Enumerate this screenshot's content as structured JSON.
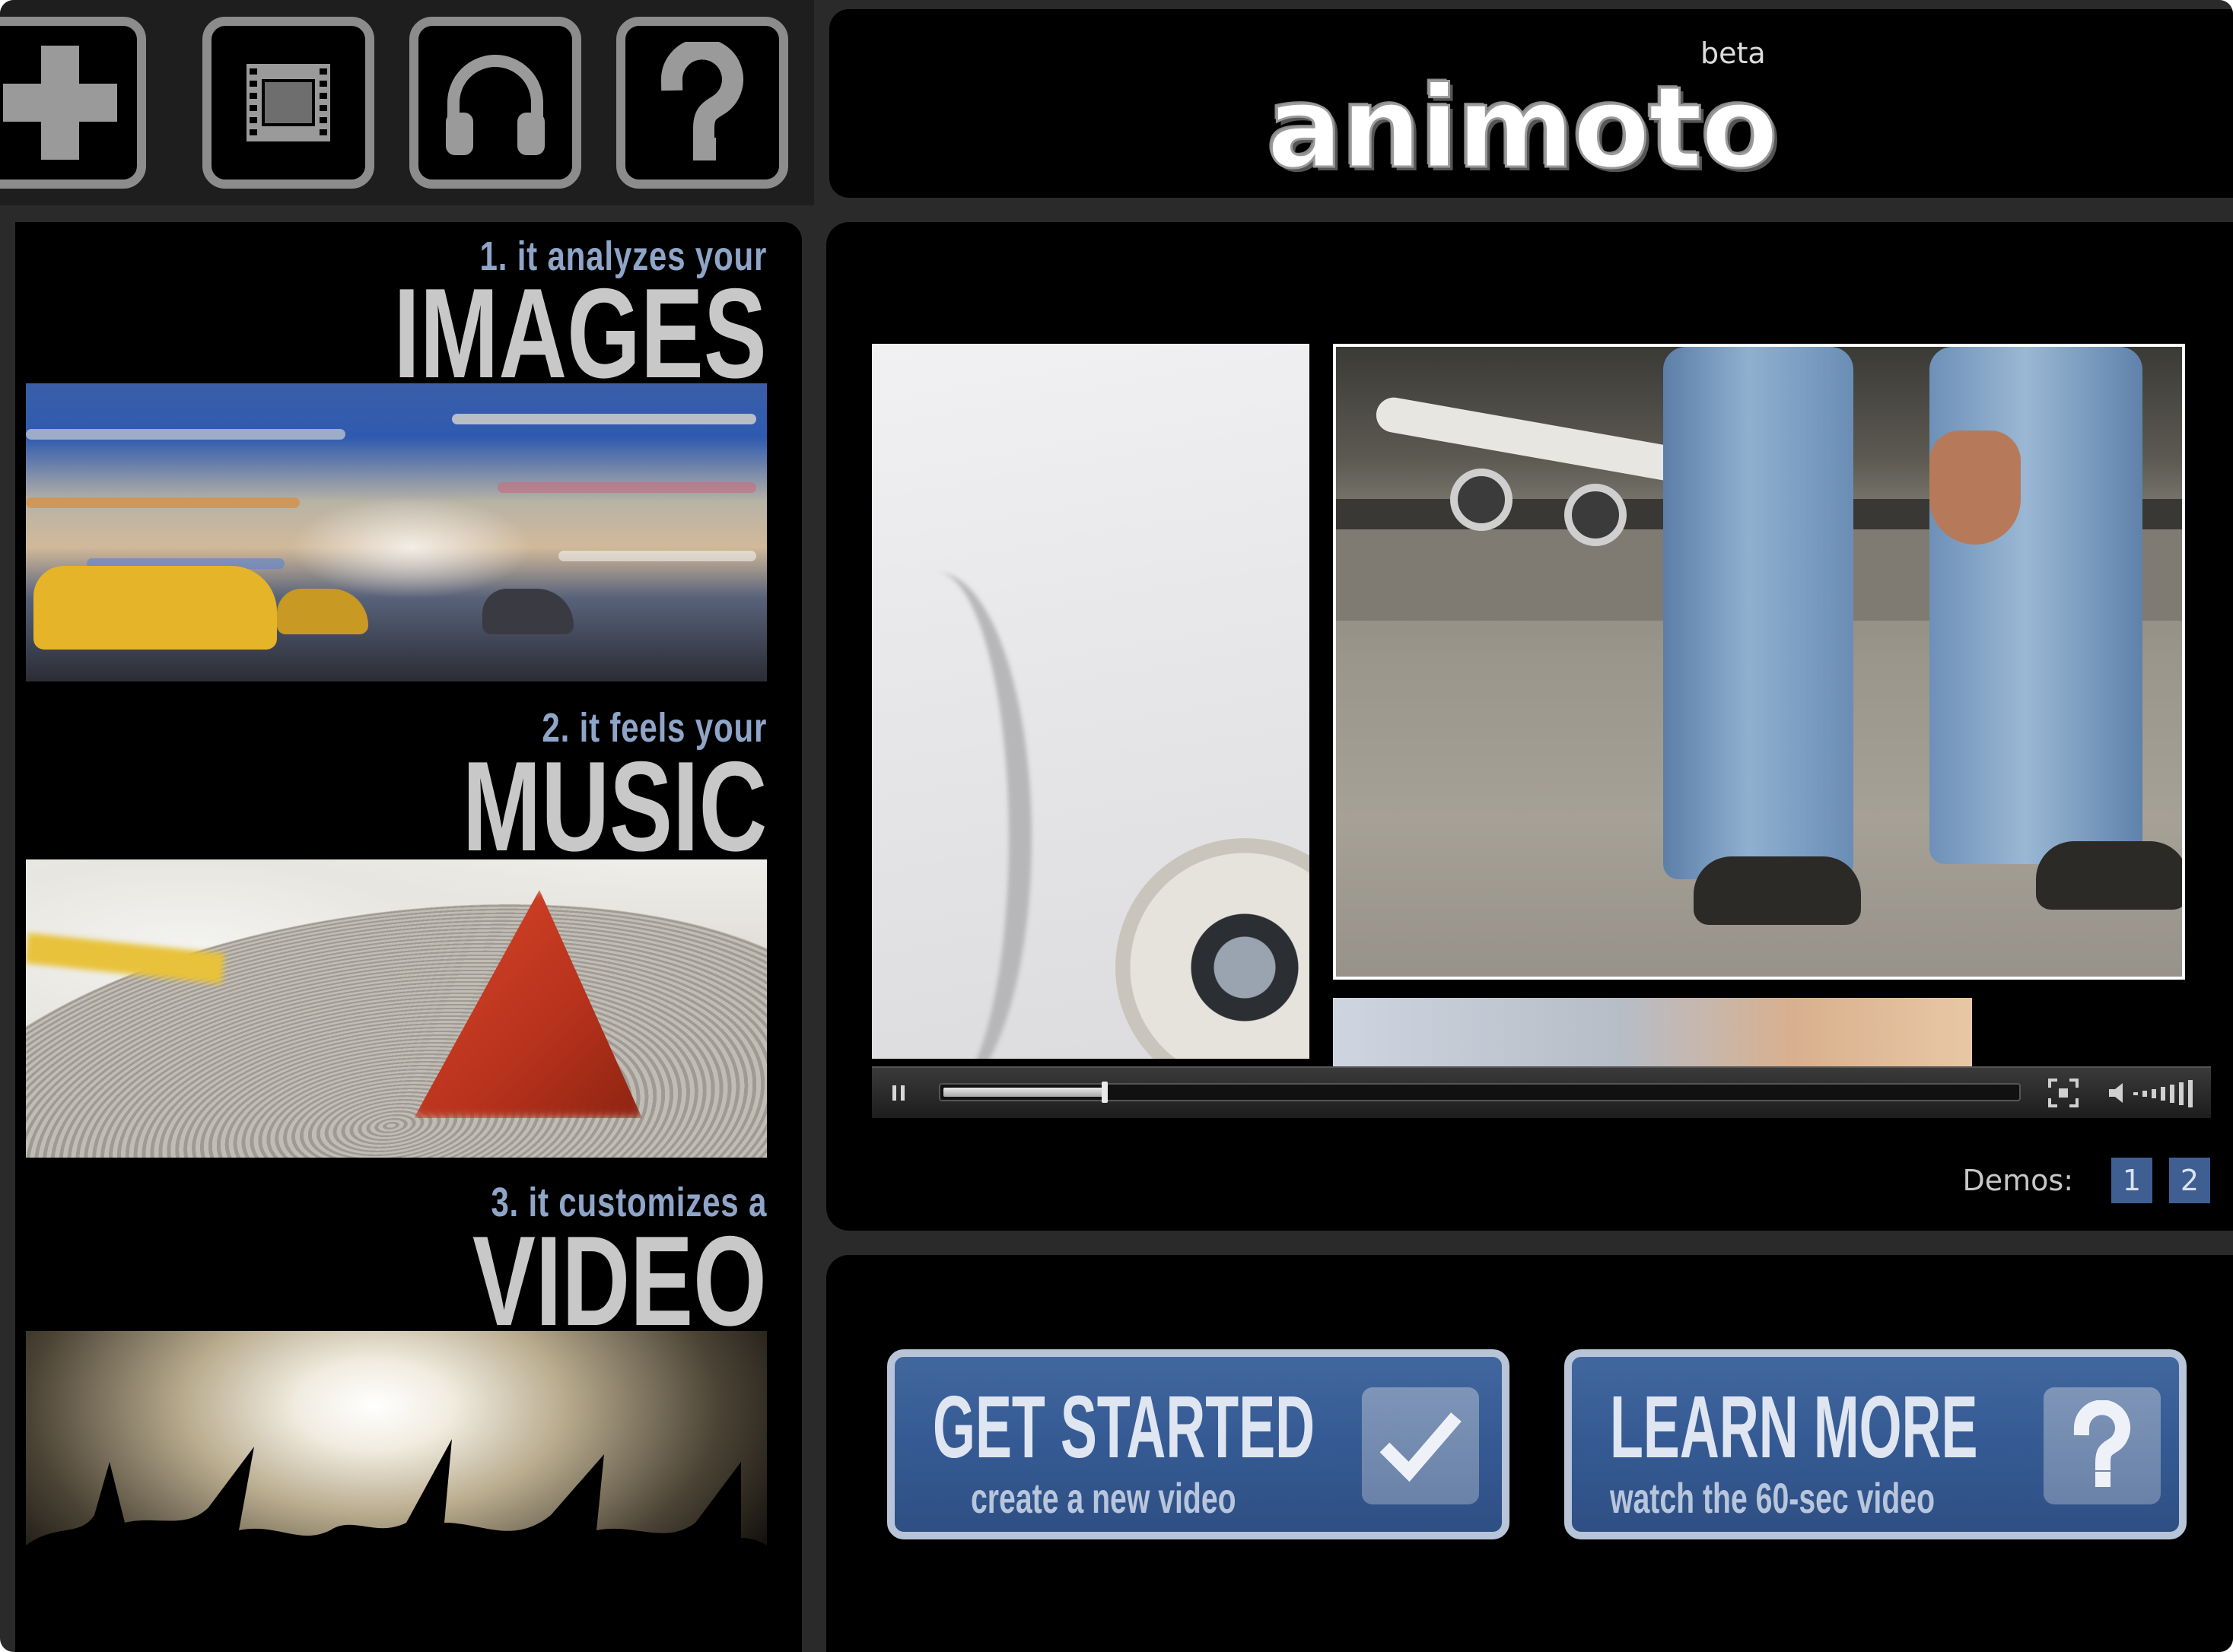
{
  "toolbar": {
    "buttons": [
      {
        "name": "add",
        "icon": "plus-icon"
      },
      {
        "name": "film",
        "icon": "film-icon"
      },
      {
        "name": "audio",
        "icon": "headphones-icon"
      },
      {
        "name": "help",
        "icon": "question-icon"
      }
    ]
  },
  "header": {
    "logo": "animoto",
    "badge": "beta"
  },
  "features": [
    {
      "caption": "1. it analyzes your",
      "title": "IMAGES"
    },
    {
      "caption": "2. it feels your",
      "title": "MUSIC"
    },
    {
      "caption": "3. it customizes a",
      "title": "VIDEO"
    }
  ],
  "player": {
    "progress": 0.15,
    "demos_label": "Demos:",
    "demos": [
      "1",
      "2"
    ]
  },
  "cta": {
    "get_started": {
      "title": "GET STARTED",
      "subtitle": "create a new video",
      "icon": "checkmark-icon"
    },
    "learn_more": {
      "title": "LEARN MORE",
      "subtitle": "watch the 60-sec video",
      "icon": "question-icon"
    }
  },
  "colors": {
    "background": "#000000",
    "accent_blue": "#355a93",
    "caption_blue": "#8fa5c8",
    "border_gray": "#8c8c8c"
  }
}
